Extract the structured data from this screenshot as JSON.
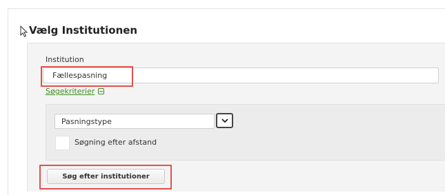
{
  "page": {
    "title": "Vælg Institutionen"
  },
  "form": {
    "institution_label": "Institution",
    "institution_value": "Fællespasning",
    "criteria_link": "Søgekriterier",
    "type_select_value": "Pasningstype",
    "distance_checkbox_label": "Søgning efter afstand",
    "search_button": "Søg efter institutioner"
  },
  "icons": {
    "cursor": "mouse-pointer-icon",
    "criteria_toggle": "minus-box-icon",
    "dropdown": "chevron-down-icon"
  },
  "colors": {
    "highlight": "#e2504c",
    "link": "#3c8f1e"
  }
}
